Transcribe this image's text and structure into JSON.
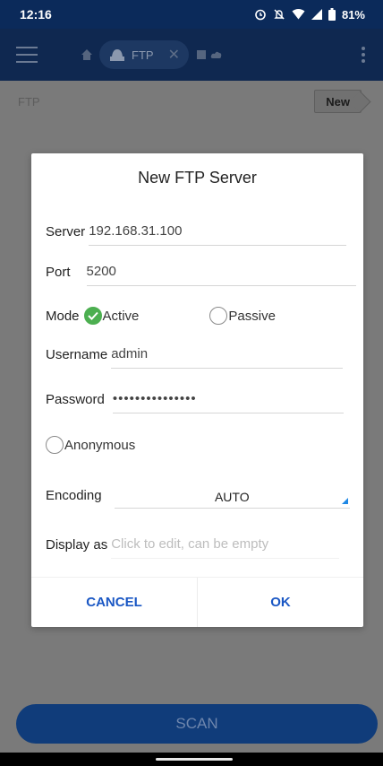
{
  "status_bar": {
    "time": "12:16",
    "battery": "81%",
    "icons": [
      "alarm-icon",
      "mute-icon",
      "wifi-icon",
      "signal-icon",
      "battery-icon"
    ]
  },
  "toolbar": {
    "tab_label": "FTP",
    "icons": [
      "menu-icon",
      "home-icon",
      "ftp-icon",
      "close-icon",
      "overflow-icon"
    ]
  },
  "breadcrumb": {
    "path": "FTP",
    "new_label": "New"
  },
  "dialog": {
    "title": "New FTP Server",
    "server": {
      "label": "Server",
      "value": "192.168.31.100"
    },
    "port": {
      "label": "Port",
      "value": "5200"
    },
    "mode": {
      "label": "Mode",
      "options": [
        "Active",
        "Passive"
      ],
      "selected": "Active"
    },
    "username": {
      "label": "Username",
      "value": "admin"
    },
    "password": {
      "label": "Password",
      "value": "•••••••••••••••"
    },
    "anonymous": {
      "label": "Anonymous",
      "checked": false
    },
    "encoding": {
      "label": "Encoding",
      "value": "AUTO"
    },
    "display_as": {
      "label": "Display as",
      "placeholder": "Click to edit, can be empty"
    },
    "cancel_label": "CANCEL",
    "ok_label": "OK"
  },
  "scan_label": "SCAN",
  "colors": {
    "accent": "#1a57c4",
    "check": "#4caf50",
    "toolbar": "#0f2850",
    "select_corner": "#1e88e5"
  }
}
